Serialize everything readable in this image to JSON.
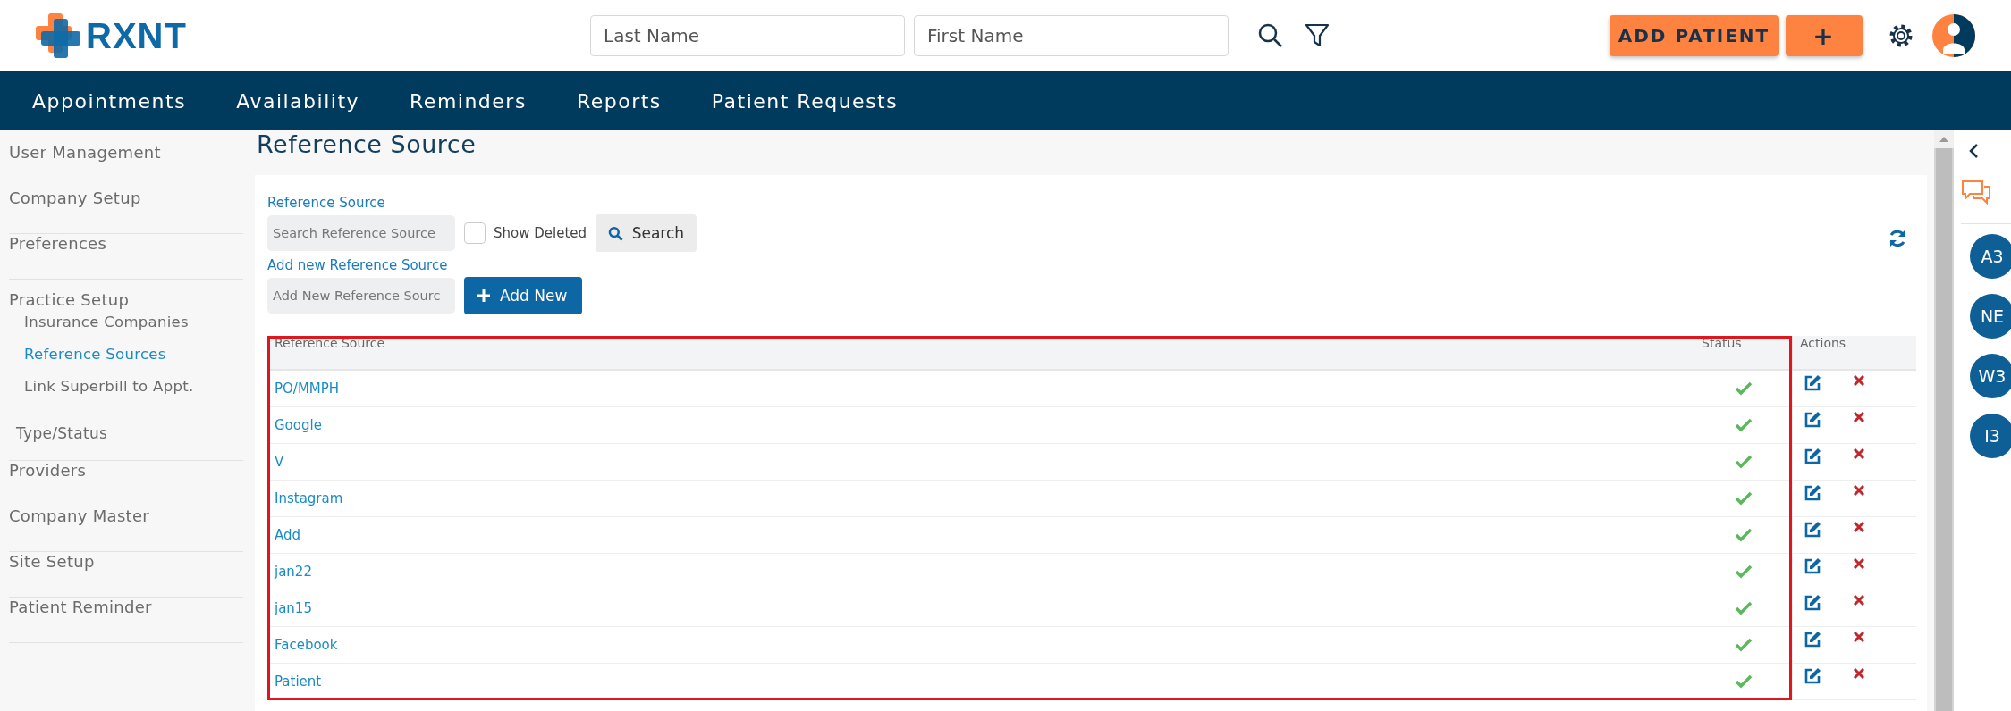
{
  "header": {
    "logo": "RXNT",
    "last_name": {
      "placeholder": "Last Name"
    },
    "first_name": {
      "placeholder": "First Name"
    },
    "buttons": [
      {
        "label": "ADD PATIENT"
      },
      {
        "label": "+"
      }
    ]
  },
  "nav": [
    "Appointments",
    "Availability",
    "Reminders",
    "Reports",
    "Patient Requests"
  ],
  "sidebar": [
    {
      "label": "User Management",
      "selected": false
    },
    {
      "label": "Company Setup",
      "selected": false
    },
    {
      "label": "Preferences",
      "selected": false
    },
    {
      "label": "Practice Setup",
      "selected": false,
      "children": [
        {
          "label": "Insurance Companies",
          "kind": "link",
          "selected": false
        },
        {
          "label": "Reference Sources",
          "kind": "link",
          "selected": true
        },
        {
          "label": "Link Superbill to Appt.",
          "kind": "link",
          "selected": false
        },
        {
          "label": "Type/Status",
          "kind": "plain",
          "selected": false
        }
      ]
    },
    {
      "label": "Providers",
      "selected": false
    },
    {
      "label": "Company Master",
      "selected": false
    },
    {
      "label": "Site Setup",
      "selected": false
    },
    {
      "label": "Patient Reminder",
      "selected": false
    }
  ],
  "page": {
    "title": "Reference Source",
    "search_label": "Reference Source",
    "search_field": {
      "placeholder": "Search Reference Source"
    },
    "show_deleted": {
      "label": "Show Deleted",
      "checked": false
    },
    "search_button": "Search",
    "add_label": "Add new Reference Source",
    "add_field": {
      "placeholder": "Add New Reference Sourc"
    },
    "add_button": "Add New"
  },
  "table": {
    "highlighted": true,
    "columns": [
      "Reference Source",
      "Status",
      "Actions"
    ],
    "rows": [
      {
        "name": "PO/MMPH",
        "active": true
      },
      {
        "name": "Google",
        "active": true
      },
      {
        "name": "V",
        "active": true
      },
      {
        "name": "Instagram",
        "active": true
      },
      {
        "name": "Add",
        "active": true
      },
      {
        "name": "jan22",
        "active": true
      },
      {
        "name": "jan15",
        "active": true
      },
      {
        "name": "Facebook",
        "active": true
      },
      {
        "name": "Patient",
        "active": true
      }
    ]
  },
  "rail": {
    "avatars": [
      "A3",
      "NE",
      "W3",
      "I3"
    ]
  }
}
